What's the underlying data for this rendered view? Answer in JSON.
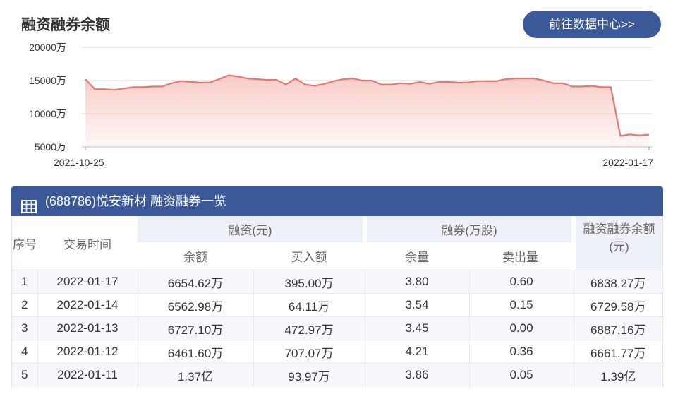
{
  "header": {
    "title": "融资融券余额",
    "button_label": "前往数据中心>>"
  },
  "chart_data": {
    "type": "area",
    "color": "#e07a72",
    "fill_color": "#f7c9c4",
    "y_ticks": [
      "20000万",
      "15000万",
      "10000万",
      "5000万"
    ],
    "x_ticks": [
      "2021-10-25",
      "2022-01-17"
    ],
    "ylim": [
      5000,
      20000
    ],
    "grid": true,
    "x": [
      "2021-10-25",
      "",
      "",
      "",
      "",
      "",
      "",
      "",
      "",
      "",
      "",
      "",
      "",
      "",
      "",
      "",
      "",
      "",
      "",
      "",
      "",
      "",
      "",
      "",
      "",
      "",
      "",
      "",
      "",
      "",
      "",
      "",
      "",
      "",
      "",
      "",
      "",
      "",
      "",
      "",
      "",
      "",
      "",
      "",
      "",
      "",
      "",
      "",
      "",
      "",
      "",
      "",
      "",
      "",
      "",
      "",
      "",
      "",
      "",
      "2022-01-17"
    ],
    "values": [
      15200,
      13700,
      13700,
      13600,
      13800,
      14000,
      14000,
      14100,
      14100,
      14600,
      14900,
      14800,
      14700,
      14700,
      15200,
      15800,
      15600,
      15300,
      15200,
      15100,
      15100,
      14400,
      15300,
      14400,
      14200,
      14500,
      14900,
      15200,
      15300,
      15000,
      15000,
      14400,
      14400,
      14600,
      14500,
      14800,
      14500,
      14800,
      14800,
      14700,
      14700,
      14900,
      14900,
      14900,
      15200,
      15300,
      15300,
      15300,
      15000,
      14600,
      14600,
      14100,
      14100,
      14200,
      14000,
      14000,
      6661,
      6887,
      6729,
      6838
    ]
  },
  "panel": {
    "title": "(688786)悦安新材 融资融券一览",
    "icon": "table-icon"
  },
  "table": {
    "group_headers": {
      "index": "序号",
      "date": "交易时间",
      "financing": "融资(元)",
      "securities": "融券(万股)",
      "total": "融资融券余额(元)"
    },
    "sub_headers": {
      "fin_balance": "余额",
      "fin_buy": "买入额",
      "sec_balance": "余量",
      "sec_sell": "卖出量"
    },
    "rows": [
      [
        "1",
        "2022-01-17",
        "6654.62万",
        "395.00万",
        "3.80",
        "0.60",
        "6838.27万"
      ],
      [
        "2",
        "2022-01-14",
        "6562.98万",
        "64.11万",
        "3.54",
        "0.15",
        "6729.58万"
      ],
      [
        "3",
        "2022-01-13",
        "6727.10万",
        "472.97万",
        "3.45",
        "0.00",
        "6887.16万"
      ],
      [
        "4",
        "2022-01-12",
        "6461.60万",
        "707.07万",
        "4.21",
        "0.36",
        "6661.77万"
      ],
      [
        "5",
        "2022-01-11",
        "1.37亿",
        "93.97万",
        "3.86",
        "0.05",
        "1.39亿"
      ]
    ]
  }
}
